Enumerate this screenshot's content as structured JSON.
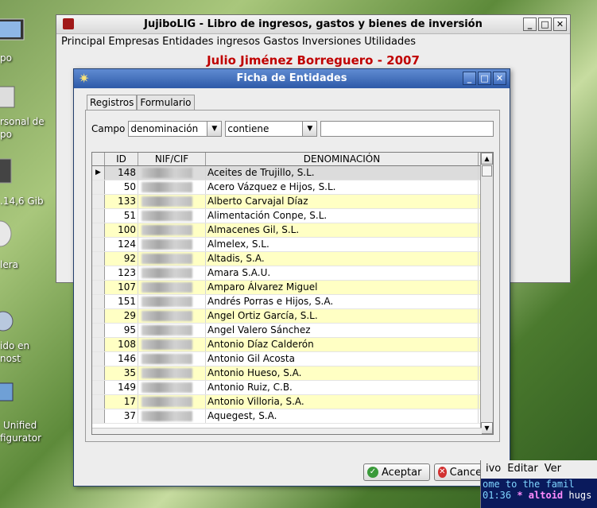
{
  "desktop": {
    "labels": [
      "po",
      "rsonal de",
      "po",
      ".14,6 Gib",
      "lera",
      "ido en",
      "nost",
      "Unified",
      "figurator"
    ]
  },
  "main_window": {
    "title": "JujiboLIG - Libro de ingresos, gastos y bienes de inversión",
    "menu": [
      "Principal",
      "Empresas",
      "Entidades",
      "ingresos",
      "Gastos",
      "Inversiones",
      "Utilidades"
    ],
    "banner": "Julio Jiménez Borreguero - 2007"
  },
  "dialog": {
    "title": "Ficha de Entidades",
    "tabs": [
      "Registros",
      "Formulario"
    ],
    "filter": {
      "label": "Campo",
      "field": "denominación",
      "operator": "contiene",
      "value": ""
    },
    "columns": [
      "ID",
      "NIF/CIF",
      "DENOMINACIÓN"
    ],
    "rows": [
      {
        "id": "148",
        "nif": "",
        "name": "Aceites de Trujillo, S.L."
      },
      {
        "id": "50",
        "nif": "",
        "name": "Acero Vázquez e Hijos, S.L."
      },
      {
        "id": "133",
        "nif": "",
        "name": "Alberto Carvajal Díaz"
      },
      {
        "id": "51",
        "nif": "",
        "name": "Alimentación Conpe, S.L."
      },
      {
        "id": "100",
        "nif": "",
        "name": "Almacenes Gil, S.L."
      },
      {
        "id": "124",
        "nif": "",
        "name": "Almelex, S.L."
      },
      {
        "id": "92",
        "nif": "",
        "name": "Altadis, S.A."
      },
      {
        "id": "123",
        "nif": "",
        "name": "Amara S.A.U."
      },
      {
        "id": "107",
        "nif": "",
        "name": "Amparo Álvarez Miguel"
      },
      {
        "id": "151",
        "nif": "",
        "name": "Andrés Porras e Hijos, S.A."
      },
      {
        "id": "29",
        "nif": "",
        "name": "Angel Ortiz García, S.L."
      },
      {
        "id": "95",
        "nif": "",
        "name": "Angel Valero Sánchez"
      },
      {
        "id": "108",
        "nif": "",
        "name": "Antonio Díaz Calderón"
      },
      {
        "id": "146",
        "nif": "",
        "name": "Antonio Gil Acosta"
      },
      {
        "id": "35",
        "nif": "",
        "name": "Antonio Hueso, S.A."
      },
      {
        "id": "149",
        "nif": "",
        "name": "Antonio Ruiz, C.B."
      },
      {
        "id": "17",
        "nif": "",
        "name": "Antonio Villoria, S.A."
      },
      {
        "id": "37",
        "nif": "",
        "name": "Aquegest, S.A."
      }
    ],
    "accept_label": "Aceptar",
    "cancel_label": "Cancelar"
  },
  "terminal": {
    "menu": [
      "ivo",
      "Editar",
      "Ver"
    ],
    "line1": "ome to the famil",
    "line2_time": "01:36",
    "line2_nick": "* altoid",
    "line2_text": "hugs"
  },
  "colors": {
    "title_blue": "#2e5aa8",
    "banner_red": "#c00000",
    "row_alt": "#ffffc4"
  }
}
